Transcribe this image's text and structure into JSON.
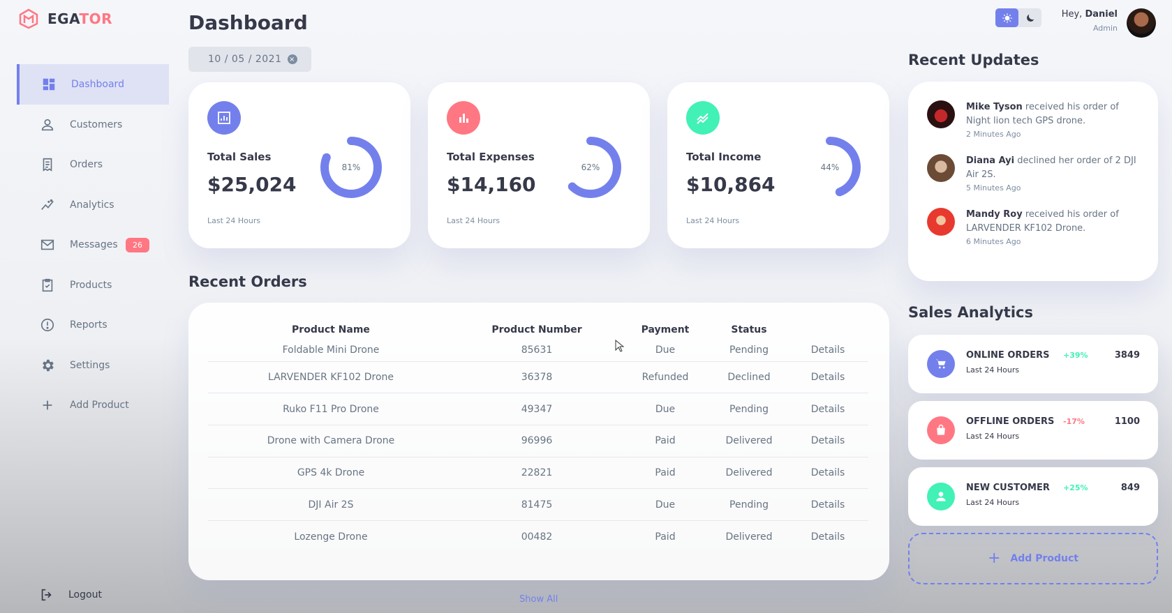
{
  "brand": {
    "prefix": "EGA",
    "suffix": "TOR"
  },
  "sidebar": {
    "items": [
      {
        "label": "Dashboard",
        "icon": "grid-icon",
        "active": true
      },
      {
        "label": "Customers",
        "icon": "person-icon"
      },
      {
        "label": "Orders",
        "icon": "receipt-icon"
      },
      {
        "label": "Analytics",
        "icon": "insights-icon"
      },
      {
        "label": "Messages",
        "icon": "mail-icon",
        "badge": "26"
      },
      {
        "label": "Products",
        "icon": "inventory-icon"
      },
      {
        "label": "Reports",
        "icon": "report-icon"
      },
      {
        "label": "Settings",
        "icon": "gear-icon"
      },
      {
        "label": "Add Product",
        "icon": "plus-icon"
      }
    ],
    "logout": "Logout"
  },
  "main": {
    "title": "Dashboard",
    "date": "10 / 05 / 2021",
    "cards": [
      {
        "label": "Total Sales",
        "value": "$25,024",
        "percent": 81,
        "percent_label": "81%",
        "sub": "Last 24 Hours",
        "color": "#7380ec",
        "icon": "bar-chart-icon"
      },
      {
        "label": "Total Expenses",
        "value": "$14,160",
        "percent": 62,
        "percent_label": "62%",
        "sub": "Last 24 Hours",
        "color": "#ff7782",
        "icon": "bar-chart-icon"
      },
      {
        "label": "Total Income",
        "value": "$10,864",
        "percent": 44,
        "percent_label": "44%",
        "sub": "Last 24 Hours",
        "color": "#41f1b6",
        "icon": "stacked-line-icon"
      }
    ],
    "recent_orders_title": "Recent Orders",
    "orders": {
      "headers": [
        "Product Name",
        "Product Number",
        "Payment",
        "Status",
        ""
      ],
      "rows": [
        {
          "name": "Foldable Mini Drone",
          "number": "85631",
          "payment": "Due",
          "status": "Pending",
          "details": "Details"
        },
        {
          "name": "LARVENDER KF102 Drone",
          "number": "36378",
          "payment": "Refunded",
          "status": "Declined",
          "details": "Details"
        },
        {
          "name": "Ruko F11 Pro Drone",
          "number": "49347",
          "payment": "Due",
          "status": "Pending",
          "details": "Details"
        },
        {
          "name": "Drone with Camera Drone",
          "number": "96996",
          "payment": "Paid",
          "status": "Delivered",
          "details": "Details"
        },
        {
          "name": "GPS 4k Drone",
          "number": "22821",
          "payment": "Paid",
          "status": "Delivered",
          "details": "Details"
        },
        {
          "name": "DJI Air 2S",
          "number": "81475",
          "payment": "Due",
          "status": "Pending",
          "details": "Details"
        },
        {
          "name": "Lozenge Drone",
          "number": "00482",
          "payment": "Paid",
          "status": "Delivered",
          "details": "Details"
        }
      ]
    },
    "show_all": "Show All"
  },
  "right": {
    "greeting": {
      "hey": "Hey,",
      "name": "Daniel",
      "role": "Admin"
    },
    "recent_updates_title": "Recent Updates",
    "updates": [
      {
        "name": "Mike Tyson",
        "text": " received his order of Night lion tech GPS drone.",
        "time": "2 Minutes Ago"
      },
      {
        "name": "Diana Ayi",
        "text": " declined her order of 2 DJI Air 2S.",
        "time": "5 Minutes Ago"
      },
      {
        "name": "Mandy Roy",
        "text": " received his order of LARVENDER KF102 Drone.",
        "time": "6 Minutes Ago"
      }
    ],
    "sales_analytics_title": "Sales Analytics",
    "analytics": [
      {
        "name": "ONLINE ORDERS",
        "sub": "Last 24 Hours",
        "pct": "+39%",
        "value": "3849",
        "color": "#7380ec",
        "pct_color": "#41f1b6",
        "icon": "cart-icon"
      },
      {
        "name": "OFFLINE ORDERS",
        "sub": "Last 24 Hours",
        "pct": "-17%",
        "value": "1100",
        "color": "#ff7782",
        "pct_color": "#ff7782",
        "icon": "bag-icon"
      },
      {
        "name": "NEW CUSTOMER",
        "sub": "Last 24 Hours",
        "pct": "+25%",
        "value": "849",
        "color": "#41f1b6",
        "pct_color": "#41f1b6",
        "icon": "person-icon"
      }
    ],
    "add_product": "Add Product"
  }
}
